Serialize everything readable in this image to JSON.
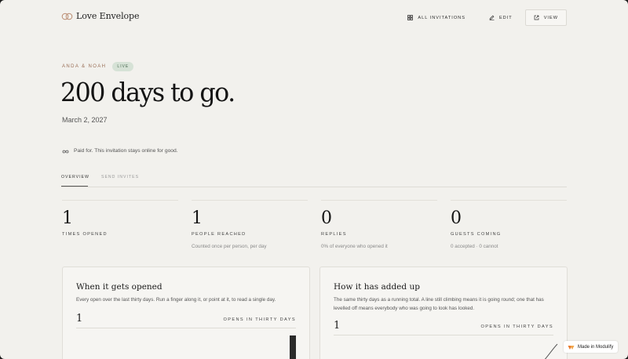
{
  "brand": {
    "name": "Love Envelope",
    "logo_icon": "interlocking-rings-icon"
  },
  "nav": {
    "all_invitations": "ALL INVITATIONS",
    "edit": "EDIT",
    "view": "VIEW"
  },
  "event": {
    "couple": "ANDA & NOAH",
    "status": "LIVE",
    "headline": "200 days to go.",
    "date": "March 2, 2027",
    "paid_note": "Paid for. This invitation stays online for good."
  },
  "tabs": [
    {
      "label": "OVERVIEW",
      "active": true
    },
    {
      "label": "SEND INVITES",
      "active": false
    }
  ],
  "stats": [
    {
      "value": "1",
      "label": "TIMES OPENED",
      "note": ""
    },
    {
      "value": "1",
      "label": "PEOPLE REACHED",
      "note": "Counted once per person, per day"
    },
    {
      "value": "0",
      "label": "REPLIES",
      "note": "0% of everyone who opened it"
    },
    {
      "value": "0",
      "label": "GUESTS COMING",
      "note": "0 accepted · 0 cannot"
    }
  ],
  "cards": [
    {
      "title": "When it gets opened",
      "description": "Every open over the last thirty days. Run a finger along it, or point at it, to read a single day.",
      "total": "1",
      "caption": "OPENS IN THIRTY DAYS"
    },
    {
      "title": "How it has added up",
      "description": "The same thirty days as a running total. A line still climbing means it is going round; one that has levelled off means everybody who was going to look has looked.",
      "total": "1",
      "caption": "OPENS IN THIRTY DAYS"
    }
  ],
  "badge": {
    "label": "Made in Modulify",
    "icon": "modulify-logo-icon"
  },
  "colors": {
    "background": "#f2f1ed",
    "accent": "#9a6f57",
    "live_badge": "#d6e2d6",
    "ink": "#141414"
  }
}
